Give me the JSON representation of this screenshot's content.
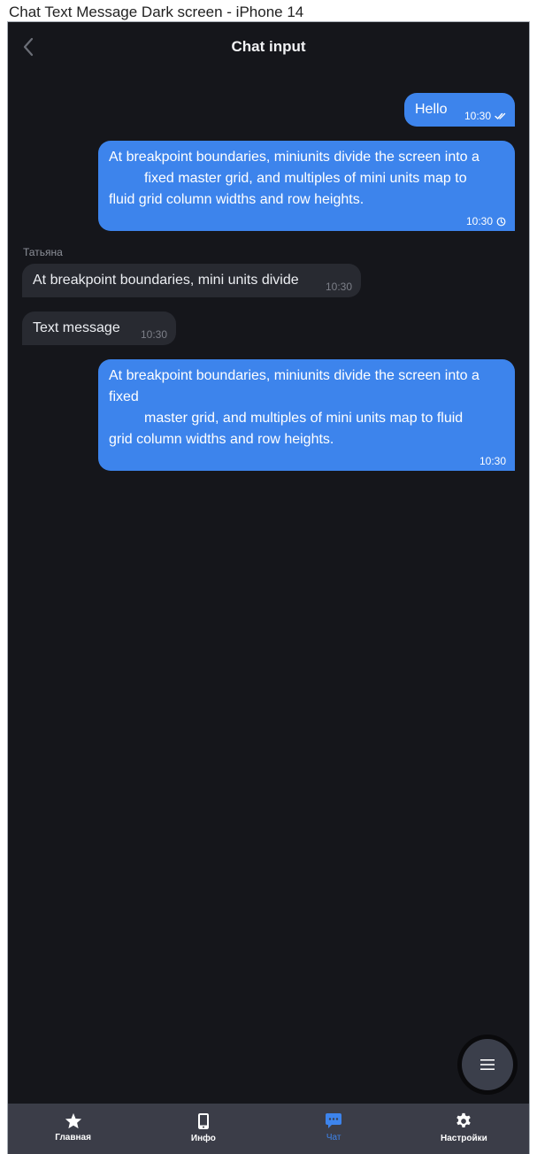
{
  "frame": {
    "title": "Chat Text Message Dark screen - iPhone 14"
  },
  "header": {
    "title": "Chat input",
    "back_icon": "chevron-left-icon"
  },
  "messages": [
    {
      "direction": "out",
      "text": "Hello",
      "time": "10:30",
      "status_icon": "double-check-icon"
    },
    {
      "direction": "out",
      "text": "At breakpoint boundaries, miniunits divide the screen into a\n         fixed master grid, and multiples of mini units map to\nfluid grid column widths and row heights.",
      "time": "10:30",
      "status_icon": "clock-icon"
    },
    {
      "direction": "in",
      "sender": "Татьяна",
      "text": "At breakpoint boundaries, mini units divide",
      "time": "10:30"
    },
    {
      "direction": "in",
      "text": "Text message",
      "time": "10:30"
    },
    {
      "direction": "out",
      "text": "At breakpoint boundaries, miniunits divide the screen into a\nfixed\n         master grid, and multiples of mini units map to fluid\ngrid column widths and row heights.",
      "time": "10:30"
    }
  ],
  "fab": {
    "icon": "menu-icon"
  },
  "tabbar": {
    "tabs": [
      {
        "label": "Главная",
        "icon": "star-icon",
        "active": false
      },
      {
        "label": "Инфо",
        "icon": "phone-device-icon",
        "active": false
      },
      {
        "label": "Чат",
        "icon": "chat-bubble-icon",
        "active": true
      },
      {
        "label": "Настройки",
        "icon": "gear-icon",
        "active": false
      }
    ]
  },
  "colors": {
    "background": "#15161b",
    "outgoing_bubble": "#3d84ec",
    "incoming_bubble": "#282a31",
    "tabbar": "#3b3d48",
    "accent": "#3d84ec"
  }
}
